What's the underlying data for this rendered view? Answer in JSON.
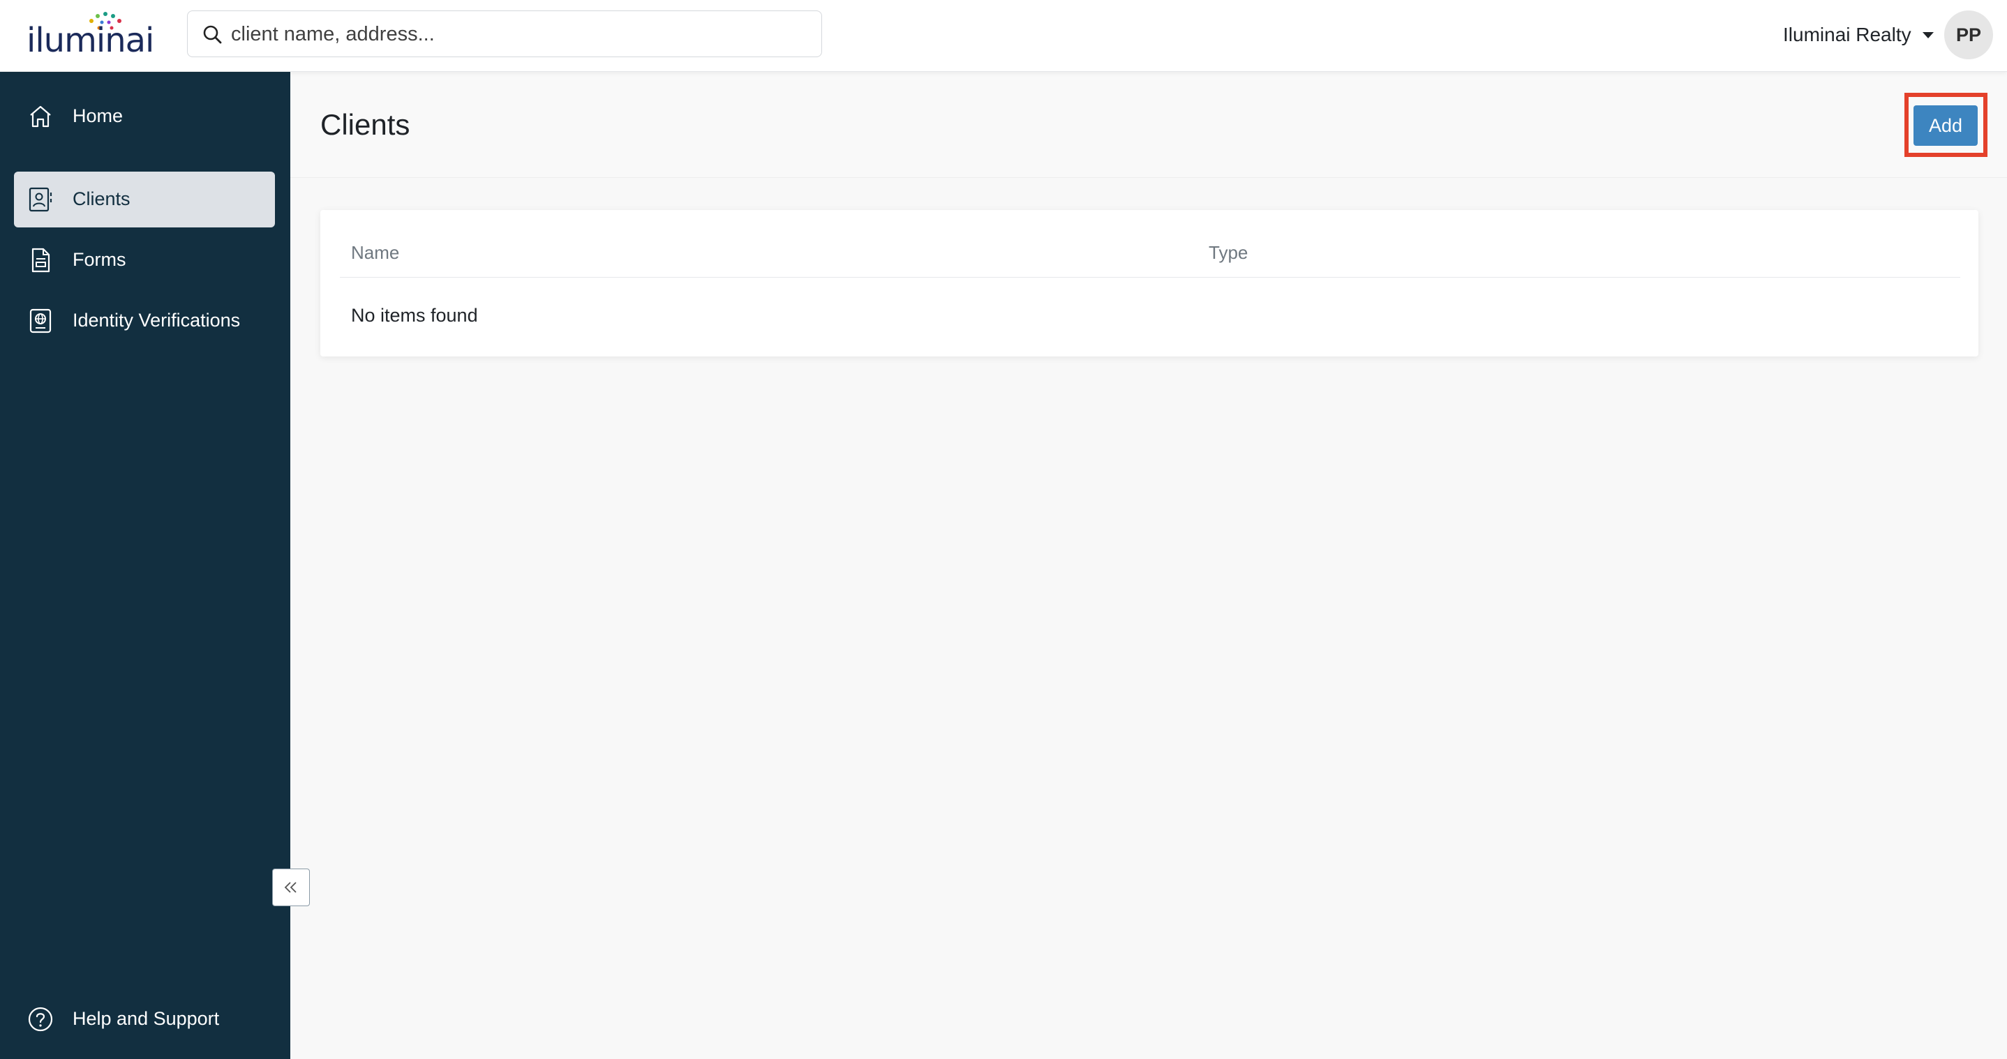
{
  "brand": {
    "logo_text": "iluminai",
    "colors": {
      "sidebar_bg": "#122f40",
      "accent_button": "#3d85c0",
      "highlight_border": "#e4412b",
      "active_nav_bg": "#dde1e6"
    }
  },
  "search": {
    "placeholder": "client name, address...",
    "value": "",
    "icon": "search-icon"
  },
  "account": {
    "name": "Iluminai Realty",
    "avatar_initials": "PP"
  },
  "sidebar": {
    "items": [
      {
        "label": "Home",
        "icon": "home-icon",
        "active": false
      },
      {
        "label": "Clients",
        "icon": "contact-card-icon",
        "active": true
      },
      {
        "label": "Forms",
        "icon": "document-icon",
        "active": false
      },
      {
        "label": "Identity Verifications",
        "icon": "id-badge-globe-icon",
        "active": false
      }
    ],
    "footer_item": {
      "label": "Help and Support",
      "icon": "question-circle-icon"
    },
    "collapse_icon": "double-chevron-left-icon"
  },
  "page": {
    "title": "Clients",
    "add_button_label": "Add"
  },
  "table": {
    "columns": [
      "Name",
      "Type"
    ],
    "rows": [],
    "empty_message": "No items found"
  }
}
